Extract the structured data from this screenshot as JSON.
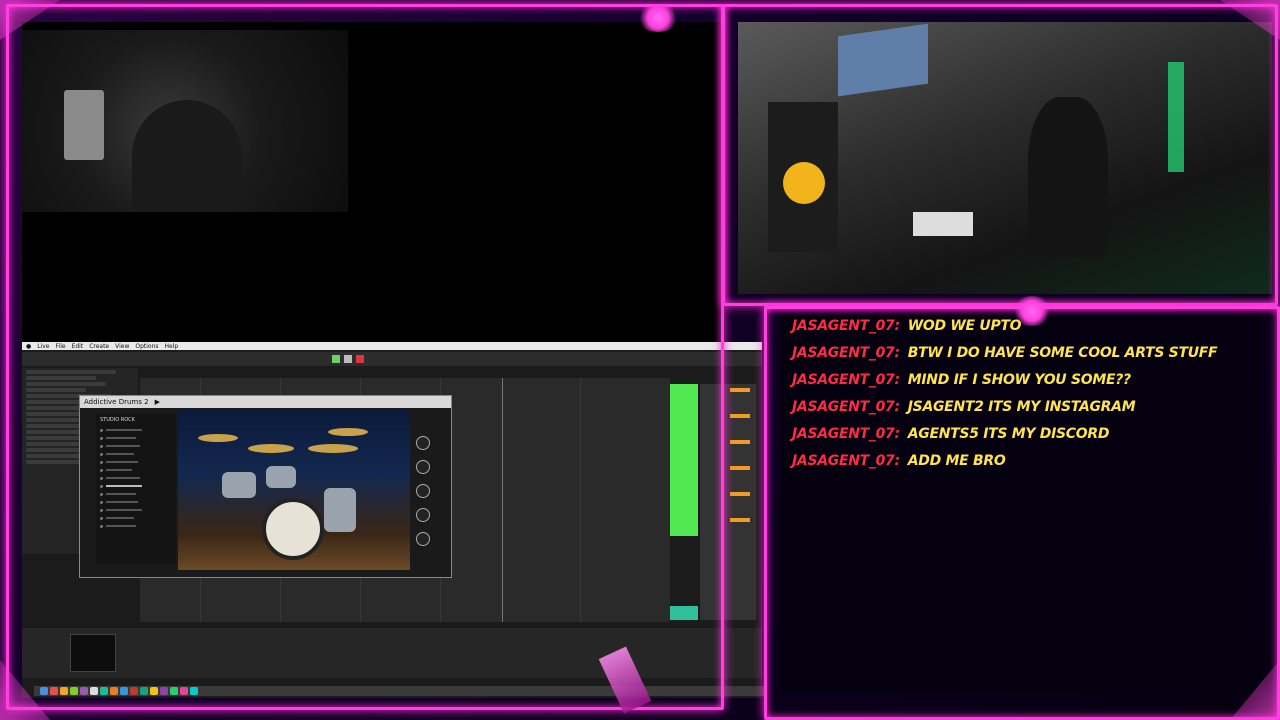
{
  "chat": {
    "messages": [
      {
        "user": "JASAGENT_07:",
        "text": "WOD WE UPTO"
      },
      {
        "user": "JASAGENT_07:",
        "text": "BTW I DO HAVE SOME COOL ARTS STUFF"
      },
      {
        "user": "JASAGENT_07:",
        "text": "MIND IF I SHOW YOU SOME??"
      },
      {
        "user": "JASAGENT_07:",
        "text": "JSAGENT2 ITS MY INSTAGRAM"
      },
      {
        "user": "JASAGENT_07:",
        "text": "AGENTS5 ITS MY DISCORD"
      },
      {
        "user": "JASAGENT_07:",
        "text": "ADD ME BRO"
      }
    ]
  },
  "daw": {
    "menu": [
      "Live",
      "File",
      "Edit",
      "Create",
      "View",
      "Options",
      "Help"
    ],
    "plugin": {
      "title": "Addictive Drums 2",
      "kit_label": "STUDIO ROCK"
    }
  },
  "colors": {
    "neon_frame": "#ff3fe0",
    "chat_user": "#ff2a45",
    "chat_text": "#ffe44d",
    "clip_green": "#52e852"
  }
}
